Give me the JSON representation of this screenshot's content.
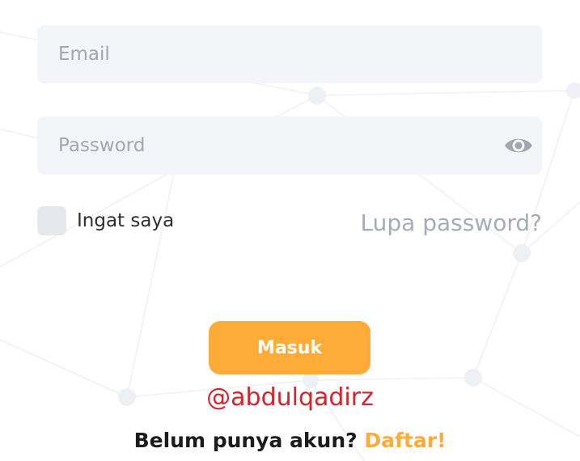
{
  "form": {
    "email_placeholder": "Email",
    "password_placeholder": "Password",
    "remember_label": "Ingat saya",
    "forgot_label": "Lupa password?",
    "login_label": "Masuk",
    "register_prompt": "Belum punya akun?",
    "register_link": "Daftar!"
  },
  "watermark": "@abdulqadirz",
  "icons": {
    "password_toggle": "eye-icon"
  },
  "colors": {
    "accent": "#ffab38",
    "field_bg": "#f3f5f9",
    "placeholder": "#a3a6b1",
    "muted_link": "#a8aab5",
    "checkbox_bg": "#e6e8ee",
    "watermark": "#d1242b",
    "text_dark": "#1b1b1b"
  }
}
